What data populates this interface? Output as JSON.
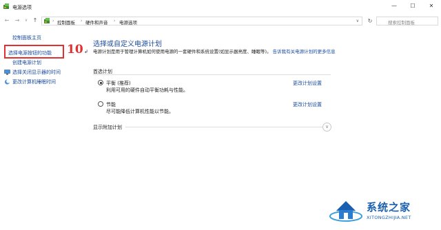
{
  "window": {
    "title": "电源选项",
    "min_glyph": "—",
    "max_glyph": "☐",
    "close_glyph": "✕"
  },
  "addressbar": {
    "back_glyph": "←",
    "forward_glyph": "→",
    "history_glyph": "∨",
    "up_glyph": "↑",
    "breadcrumbs": [
      "控制面板",
      "硬件和声音",
      "电源选项"
    ],
    "separator": "›",
    "dropdown_glyph": "∨",
    "refresh_glyph": "↻",
    "search_placeholder": "搜索控制面板"
  },
  "sidebar": {
    "home": "控制面板主页",
    "power_buttons": "选择电源按钮的功能",
    "create_plan": "创建电源计划",
    "display_off": "选择关闭显示器的时间",
    "sleep_time": "更改计算机睡眠时间"
  },
  "annotation": {
    "step_number": "10",
    "cursor_glyph": "↲"
  },
  "main": {
    "title": "选择或自定义电源计划",
    "description": "电源计划是用于管理计算机如何使用电源的一套硬件和系统设置(如显示器亮度、睡眠等)。",
    "description_link": "告诉我有关电源计划的更多信息",
    "section_label": "首选计划",
    "plans": [
      {
        "name": "平衡 (推荐)",
        "desc": "利用可用的硬件自动平衡功耗与性能。",
        "link": "更改计划设置",
        "selected": true
      },
      {
        "name": "节能",
        "desc": "尽可能降低计算机性能以节能。",
        "link": "更改计划设置",
        "selected": false
      }
    ],
    "extra_plans_label": "显示附加计划",
    "expand_glyph": "∨"
  },
  "watermark": {
    "name": "系统之家",
    "url": "XITONGZHIJIA.NET"
  },
  "colors": {
    "link": "#1a4aa0",
    "heading": "#1e4b9a",
    "highlight_red": "#e03030",
    "watermark_blue": "#1a5fb0"
  }
}
